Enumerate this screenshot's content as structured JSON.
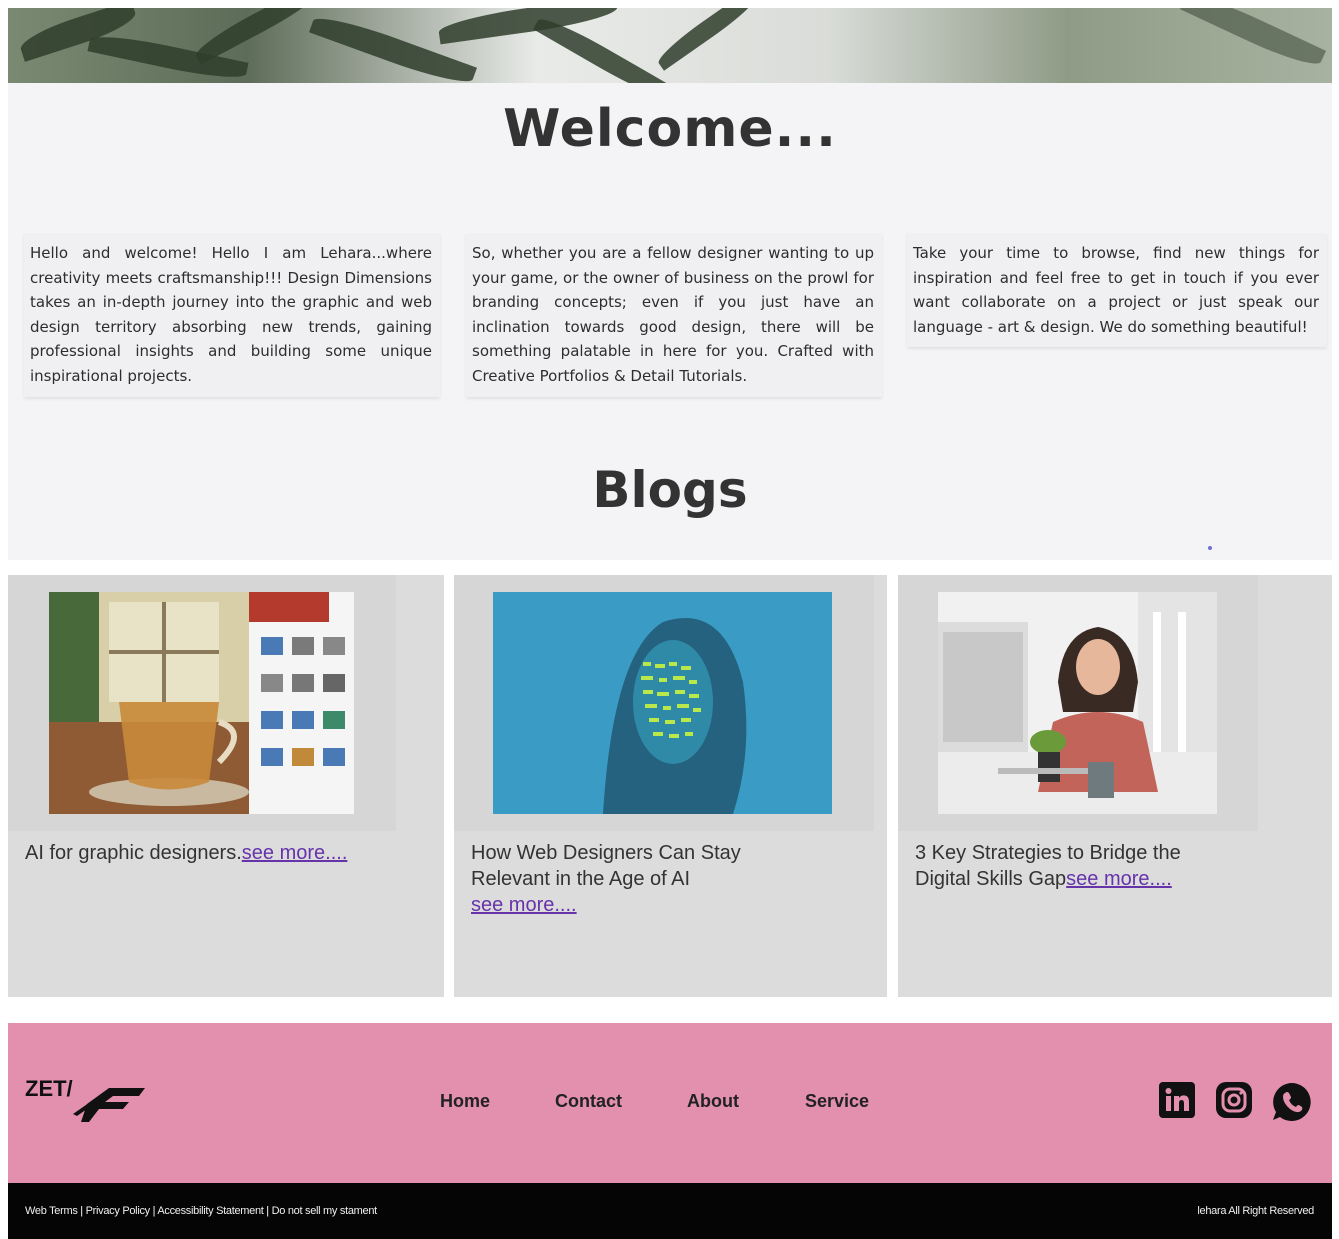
{
  "welcome": {
    "title": "Welcome...",
    "cards": [
      "Hello and welcome! Hello I am Lehara...where creativity meets craftsmanship!!! Design Dimensions takes an in-depth journey into the graphic and web design territory absorbing new trends, gaining professional insights and building some unique inspirational projects.",
      "So, whether you are a fellow designer wanting to up your game, or the owner of business on the prowl for branding concepts; even if you just have an inclination towards good design, there will be something palatable in here for you. Crafted with Creative Portfolios & Detail Tutorials.",
      "Take your time to browse, find new things for inspiration and feel free to get in touch if you ever want collaborate on a project or just speak our language - art & design. We do something beautiful!"
    ]
  },
  "blogs": {
    "title": "Blogs",
    "items": [
      {
        "title": "AI for graphic designers.",
        "link": "see more...."
      },
      {
        "title": "How Web Designers Can Stay Relevant in the Age of AI",
        "link": "see more...."
      },
      {
        "title": "3 Key Strategies to Bridge the Digital Skills Gap",
        "link": "see more...."
      }
    ]
  },
  "footer": {
    "logo_text": "ZET/",
    "nav": [
      "Home",
      "Contact",
      "About",
      "Service"
    ],
    "social": [
      "linkedin-icon",
      "instagram-icon",
      "whatsapp-icon"
    ],
    "legal": [
      "Web Terms",
      "Privacy Policy",
      "Accessibility Statement",
      "Do not sell my stament"
    ],
    "legal_separator": " | ",
    "rights": "lehara All Right Reserved",
    "colors": {
      "footer_bg": "#e290ae",
      "bottom_bg": "#050505"
    }
  }
}
